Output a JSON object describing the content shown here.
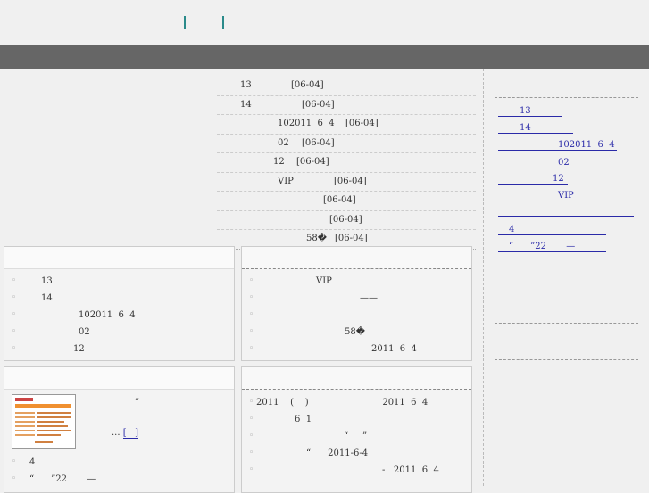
{
  "news": [
    {
      "title": "13",
      "date": "[06-04]"
    },
    {
      "title": "14",
      "date": "[06-04]"
    },
    {
      "title": "102011  6  4",
      "date": "[06-04]"
    },
    {
      "title": "02",
      "date": "[06-04]"
    },
    {
      "title": "12",
      "date": "[06-04]"
    },
    {
      "title": "VIP",
      "date": "[06-04]"
    },
    {
      "title": "",
      "date": "[06-04]"
    },
    {
      "title": "",
      "date": "[06-04]"
    },
    {
      "title": "58�",
      "date": "[06-04]"
    }
  ],
  "box1": {
    "items": [
      "13",
      "14",
      "102011  6  4",
      "02",
      "12"
    ]
  },
  "box2": {
    "items": [
      "VIP",
      "——",
      "",
      "58�",
      "2011  6  4"
    ]
  },
  "box3": {
    "quote": "”",
    "more_prefix": "...",
    "more_link": "[   ]",
    "items": [
      "4",
      "“      ”22       —"
    ]
  },
  "box4": {
    "items": [
      "2011    (    )                          2011  6  4",
      "6  1",
      "“     ”",
      "“      2011-6-4",
      "-   2011  6  4"
    ]
  },
  "sidebar": {
    "links": [
      "13",
      "14",
      "102011  6  4",
      "02",
      "12",
      "VIP",
      "",
      "4",
      "“      ”22       —",
      ""
    ]
  }
}
